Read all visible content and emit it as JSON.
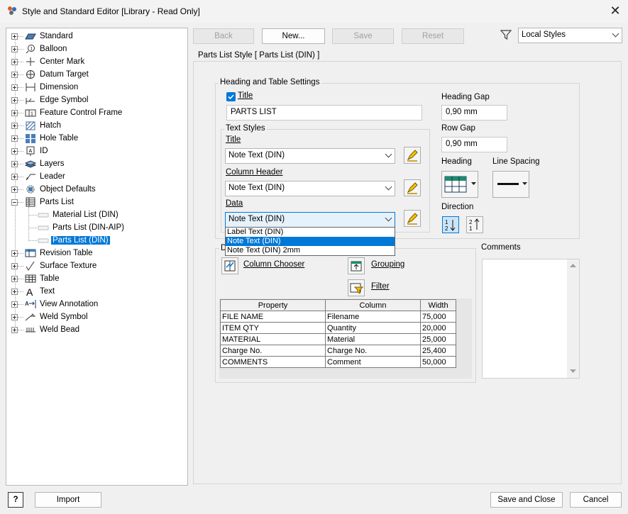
{
  "window": {
    "title": "Style and Standard Editor [Library - Read Only]"
  },
  "tree": {
    "items": [
      {
        "label": "Standard",
        "icon": "standard-icon"
      },
      {
        "label": "Balloon",
        "icon": "balloon-icon"
      },
      {
        "label": "Center Mark",
        "icon": "center-mark-icon"
      },
      {
        "label": "Datum Target",
        "icon": "datum-target-icon"
      },
      {
        "label": "Dimension",
        "icon": "dimension-icon"
      },
      {
        "label": "Edge Symbol",
        "icon": "edge-symbol-icon"
      },
      {
        "label": "Feature Control Frame",
        "icon": "feature-control-frame-icon"
      },
      {
        "label": "Hatch",
        "icon": "hatch-icon"
      },
      {
        "label": "Hole Table",
        "icon": "hole-table-icon"
      },
      {
        "label": "ID",
        "icon": "id-icon"
      },
      {
        "label": "Layers",
        "icon": "layers-icon"
      },
      {
        "label": "Leader",
        "icon": "leader-icon"
      },
      {
        "label": "Object Defaults",
        "icon": "object-defaults-icon"
      },
      {
        "label": "Parts List",
        "icon": "parts-list-icon"
      },
      {
        "label": "Material List (DIN)",
        "icon": "style-item-icon"
      },
      {
        "label": "Parts List (DIN-AIP)",
        "icon": "style-item-icon"
      },
      {
        "label": "Parts List (DIN)",
        "icon": "style-item-icon"
      },
      {
        "label": "Revision Table",
        "icon": "revision-table-icon"
      },
      {
        "label": "Surface Texture",
        "icon": "surface-texture-icon"
      },
      {
        "label": "Table",
        "icon": "table-icon"
      },
      {
        "label": "Text",
        "icon": "text-icon"
      },
      {
        "label": "View Annotation",
        "icon": "view-annotation-icon"
      },
      {
        "label": "Weld Symbol",
        "icon": "weld-symbol-icon"
      },
      {
        "label": "Weld Bead",
        "icon": "weld-bead-icon"
      }
    ]
  },
  "toolbar": {
    "back": "Back",
    "new": "New...",
    "save": "Save",
    "reset": "Reset",
    "filter_value": "Local Styles"
  },
  "style": {
    "header": "Parts List Style [ Parts List (DIN) ]",
    "heading_group": "Heading and Table Settings",
    "title_checkbox": "Title",
    "title_checked": true,
    "title_value": "PARTS LIST",
    "heading_gap_label": "Heading Gap",
    "heading_gap": "0,90 mm",
    "row_gap_label": "Row Gap",
    "row_gap": "0,90 mm",
    "heading_label": "Heading",
    "line_spacing_label": "Line Spacing",
    "direction_label": "Direction",
    "text_styles_group": "Text Styles",
    "ts_title_label": "Title",
    "ts_title_value": "Note Text (DIN)",
    "ts_column_header_label": "Column Header",
    "ts_column_header_value": "Note Text (DIN)",
    "ts_data_label": "Data",
    "ts_data_value": "Note Text (DIN)",
    "dropdown_options": [
      "Label Text (DIN)",
      "Note Text (DIN)",
      "Note Text (DIN) 2mm"
    ],
    "dropdown_selected_index": 1,
    "default_columns_group_initial": "D",
    "column_chooser": "Column Chooser",
    "grouping": "Grouping",
    "filter": "Filter",
    "comments_label": "Comments"
  },
  "columns_table": {
    "headers": [
      "Property",
      "Column",
      "Width"
    ],
    "rows": [
      [
        "FILE NAME",
        "Filename",
        "75,000"
      ],
      [
        "ITEM QTY",
        "Quantity",
        "20,000"
      ],
      [
        "MATERIAL",
        "Material",
        "25,000"
      ],
      [
        "Charge No.",
        "Charge No.",
        "25,400"
      ],
      [
        "COMMENTS",
        "Comment",
        "50,000"
      ]
    ]
  },
  "footer": {
    "help": "?",
    "import": "Import",
    "save_close": "Save and Close",
    "cancel": "Cancel"
  },
  "colors": {
    "accent": "#0078d7",
    "icon_yellow": "#f5c400"
  }
}
